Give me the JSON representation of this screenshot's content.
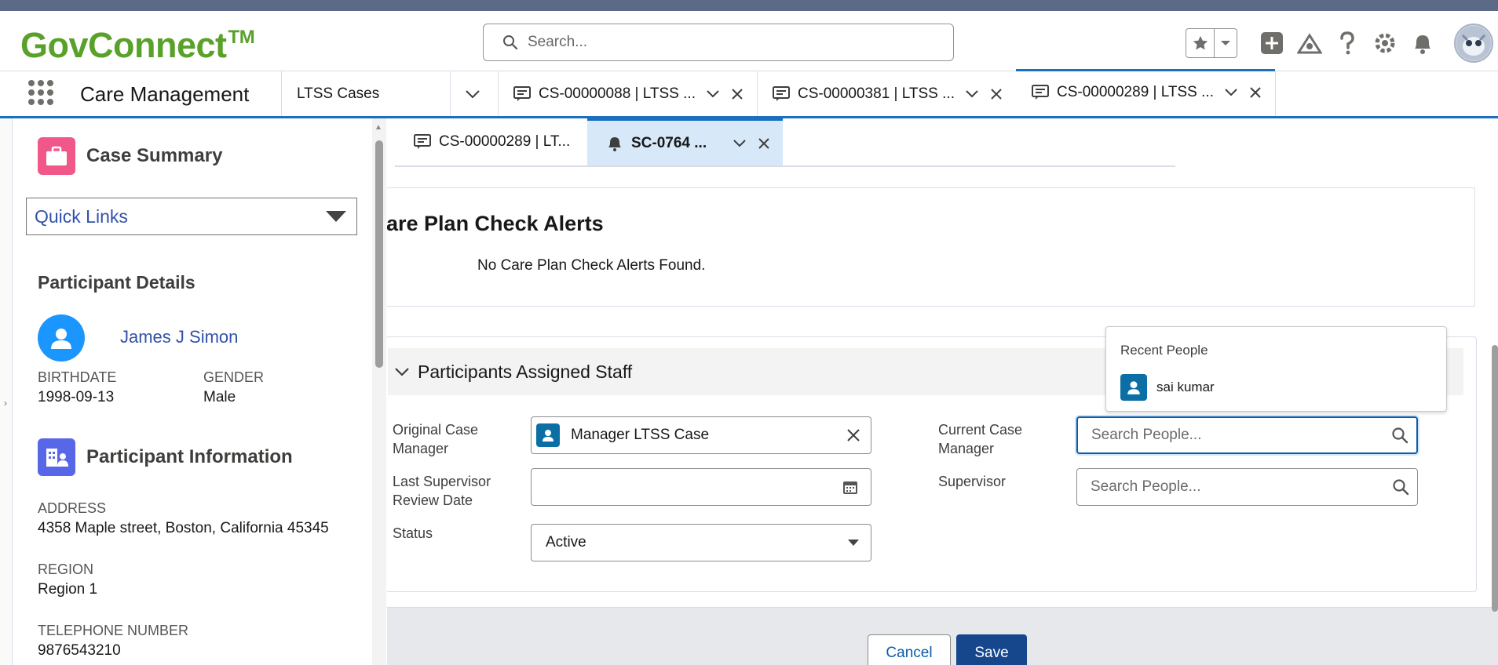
{
  "header": {
    "logo_text": "GovConnect",
    "logo_mark": "TM",
    "search_placeholder": "Search...",
    "icons": [
      "star-icon",
      "chevron-down-icon",
      "add-icon",
      "trailhead-icon",
      "help-icon",
      "setup-gear-icon",
      "bell-icon",
      "avatar"
    ]
  },
  "nav": {
    "app_name": "Care Management",
    "object_tab": "LTSS Cases",
    "tabs": [
      {
        "label": "CS-00000088 | LTSS ..."
      },
      {
        "label": "CS-00000381 | LTSS ..."
      },
      {
        "label": "CS-00000289 | LTSS ..."
      }
    ]
  },
  "sidebar": {
    "case_summary": "Case Summary",
    "quick_links": "Quick Links",
    "participant_details": "Participant Details",
    "participant_name": "James J Simon",
    "birthdate_label": "BIRTHDATE",
    "birthdate": "1998-09-13",
    "gender_label": "GENDER",
    "gender": "Male",
    "participant_information": "Participant Information",
    "address_label": "ADDRESS",
    "address": "4358 Maple street, Boston, California 45345",
    "region_label": "REGION",
    "region": "Region 1",
    "phone_label": "TELEPHONE NUMBER",
    "phone": "9876543210"
  },
  "subtabs": [
    {
      "label": "CS-00000289 | LT..."
    },
    {
      "label": "SC-0764 ..."
    }
  ],
  "alerts": {
    "title": "are Plan Check Alerts",
    "empty_message": "No Care Plan Check Alerts Found."
  },
  "staff": {
    "section_title": "Participants Assigned Staff",
    "original_cm_label": "Original Case Manager",
    "original_cm_value": "Manager LTSS Case",
    "current_cm_label": "Current Case Manager",
    "current_cm_placeholder": "Search People...",
    "last_review_label": "Last Supervisor Review Date",
    "supervisor_label": "Supervisor",
    "supervisor_placeholder": "Search People...",
    "status_label": "Status",
    "status_value": "Active"
  },
  "recent_people": {
    "heading": "Recent People",
    "items": [
      {
        "name": "sai kumar"
      }
    ]
  },
  "footer": {
    "cancel": "Cancel",
    "save": "Save"
  },
  "colors": {
    "brand_green": "#5aa12a",
    "accent_blue": "#1b6fbe",
    "case_summary_badge": "#f0588a",
    "participant_info_badge": "#5867e8",
    "save_button": "#16478c"
  }
}
